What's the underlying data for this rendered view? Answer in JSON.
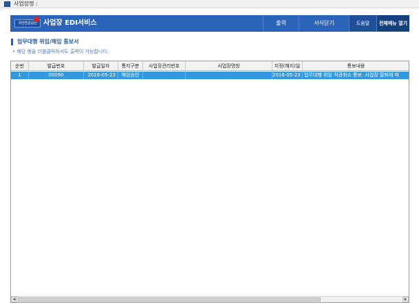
{
  "window": {
    "title": "사업장명 :"
  },
  "header": {
    "logo_text": "국민연금공단",
    "service_title": "사업장 EDI서비스",
    "buttons": {
      "print": "출력",
      "close": "서식닫기",
      "help": "도움말",
      "menu": "전체메뉴 열기"
    }
  },
  "section": {
    "title": "업무대행 위임/해임 통보서",
    "note": "• 해당 행을 더블클릭하셔도 출력이 가능합니다."
  },
  "grid": {
    "columns": [
      "순번",
      "발급번호",
      "발급일자",
      "통지구분",
      "사업장관리번호",
      "사업장명칭",
      "지정(해지)일",
      "통보내용"
    ],
    "rows": [
      [
        "1",
        "00090",
        "2016-05-23",
        "해임승인",
        "",
        "",
        "2016-05-23",
        "업무대행 위임 직권취소 통보. 사업장 탈퇴에 따"
      ]
    ]
  },
  "colors": {
    "header_bg": "#2b64b8",
    "selected_row": "#3399dd",
    "title_accent": "#2b5fa8"
  }
}
